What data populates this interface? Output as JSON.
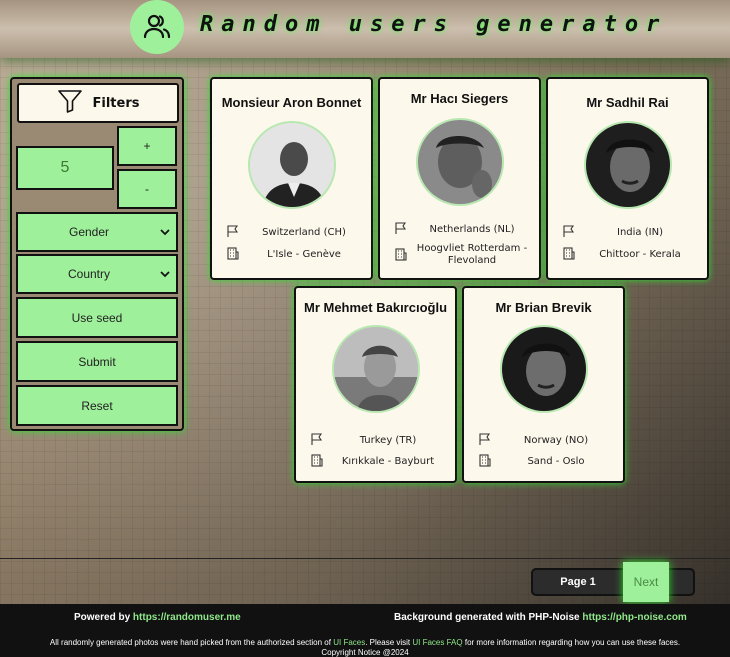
{
  "header": {
    "title": "Random users generator"
  },
  "filters": {
    "title": "Filters",
    "count_value": "5",
    "plus_label": "+",
    "minus_label": "-",
    "gender_label": "Gender",
    "country_label": "Country",
    "seed_label": "Use seed",
    "submit_label": "Submit",
    "reset_label": "Reset"
  },
  "users": [
    {
      "name": "Monsieur Aron Bonnet",
      "country": "Switzerland (CH)",
      "location": "L'Isle - Genève"
    },
    {
      "name": "Mr Hacı Siegers",
      "country": "Netherlands (NL)",
      "location": "Hoogvliet Rotterdam - Flevoland"
    },
    {
      "name": "Mr Sadhil Rai",
      "country": "India (IN)",
      "location": "Chittoor - Kerala"
    },
    {
      "name": "Mr Mehmet Bakırcıoğlu",
      "country": "Turkey (TR)",
      "location": "Kırıkkale - Bayburt"
    },
    {
      "name": "Mr Brian Brevik",
      "country": "Norway (NO)",
      "location": "Sand - Oslo"
    }
  ],
  "pagination": {
    "page_label": "Page 1",
    "next_label": "Next"
  },
  "footer": {
    "powered_prefix": "Powered by",
    "powered_link": "https://randomuser.me",
    "bg_prefix": "Background generated with PHP-Noise",
    "bg_link": "https://php-noise.com",
    "note_1": "All randomly generated photos were hand picked from the authorized section of",
    "note_link_1": "UI Faces",
    "note_2": ". Please visit",
    "note_link_2": "UI Faces FAQ",
    "note_3": "for more information regarding how you can use these faces.",
    "copyright": "Copyright Notice @2024"
  },
  "colors": {
    "accent": "#9ff09b",
    "glow": "#2edc2e",
    "card_bg": "#fdf8ec",
    "footer_bg": "#111111"
  }
}
